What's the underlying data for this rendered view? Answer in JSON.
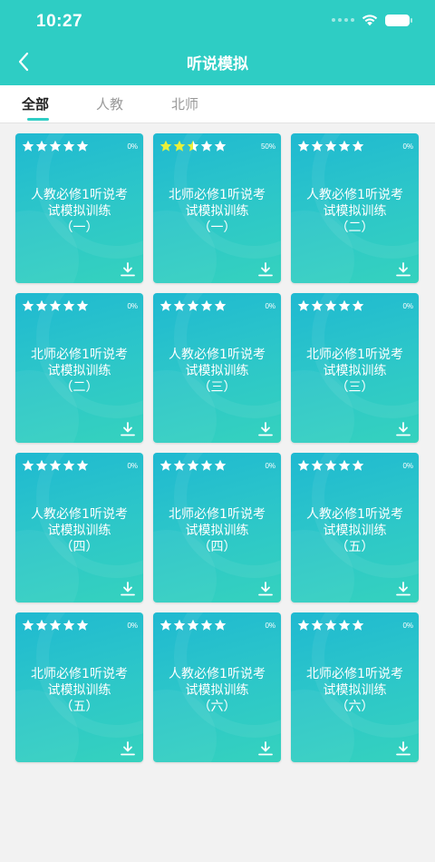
{
  "status_bar": {
    "time": "10:27"
  },
  "nav": {
    "title": "听说模拟"
  },
  "tabs": [
    {
      "label": "全部",
      "active": true
    },
    {
      "label": "人教",
      "active": false
    },
    {
      "label": "北师",
      "active": false
    }
  ],
  "colors": {
    "accent": "#2ecdc4",
    "star_empty": "#ffffff",
    "star_filled": "#e8f03a"
  },
  "icons": {
    "back": "chevron-left-icon",
    "wifi": "wifi-icon",
    "battery": "battery-icon",
    "star": "star-icon",
    "download": "download-icon"
  },
  "cards": [
    {
      "line1": "人教必修1听说考",
      "line2": "试模拟训练",
      "line3": "（一）",
      "progress": "0%",
      "stars_filled": 0,
      "stars_total": 5
    },
    {
      "line1": "北师必修1听说考",
      "line2": "试模拟训练",
      "line3": "（一）",
      "progress": "50%",
      "stars_filled": 2.5,
      "stars_total": 5
    },
    {
      "line1": "人教必修1听说考",
      "line2": "试模拟训练",
      "line3": "（二）",
      "progress": "0%",
      "stars_filled": 0,
      "stars_total": 5
    },
    {
      "line1": "北师必修1听说考",
      "line2": "试模拟训练",
      "line3": "（二）",
      "progress": "0%",
      "stars_filled": 0,
      "stars_total": 5
    },
    {
      "line1": "人教必修1听说考",
      "line2": "试模拟训练",
      "line3": "（三）",
      "progress": "0%",
      "stars_filled": 0,
      "stars_total": 5
    },
    {
      "line1": "北师必修1听说考",
      "line2": "试模拟训练",
      "line3": "（三）",
      "progress": "0%",
      "stars_filled": 0,
      "stars_total": 5
    },
    {
      "line1": "人教必修1听说考",
      "line2": "试模拟训练",
      "line3": "（四）",
      "progress": "0%",
      "stars_filled": 0,
      "stars_total": 5
    },
    {
      "line1": "北师必修1听说考",
      "line2": "试模拟训练",
      "line3": "（四）",
      "progress": "0%",
      "stars_filled": 0,
      "stars_total": 5
    },
    {
      "line1": "人教必修1听说考",
      "line2": "试模拟训练",
      "line3": "（五）",
      "progress": "0%",
      "stars_filled": 0,
      "stars_total": 5
    },
    {
      "line1": "北师必修1听说考",
      "line2": "试模拟训练",
      "line3": "（五）",
      "progress": "0%",
      "stars_filled": 0,
      "stars_total": 5
    },
    {
      "line1": "人教必修1听说考",
      "line2": "试模拟训练",
      "line3": "（六）",
      "progress": "0%",
      "stars_filled": 0,
      "stars_total": 5
    },
    {
      "line1": "北师必修1听说考",
      "line2": "试模拟训练",
      "line3": "（六）",
      "progress": "0%",
      "stars_filled": 0,
      "stars_total": 5
    }
  ]
}
